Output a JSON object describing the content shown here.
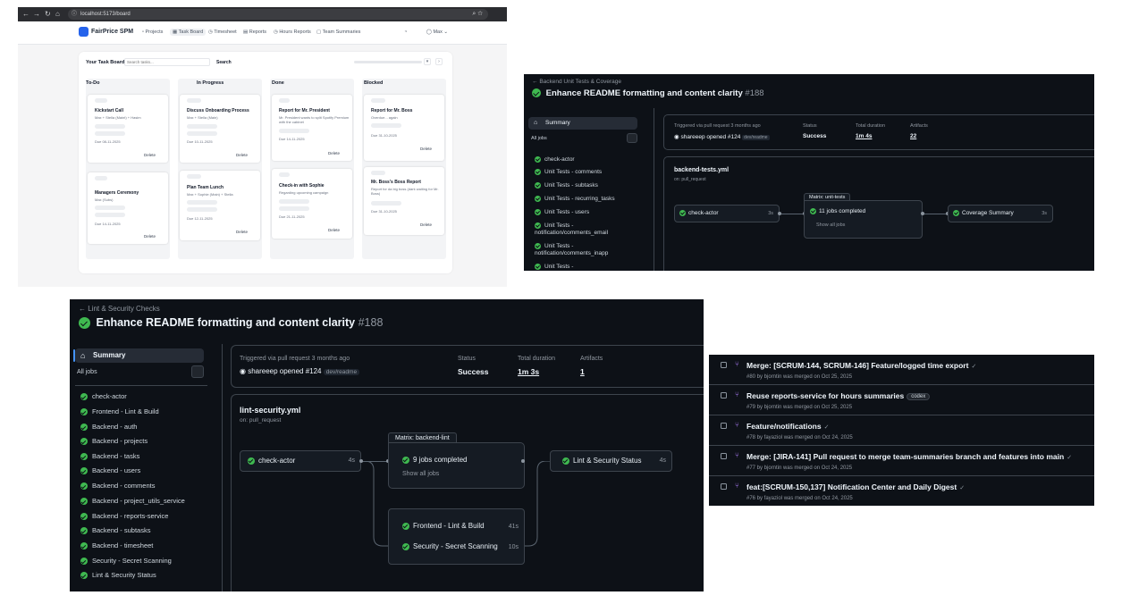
{
  "taskboard": {
    "browser": {
      "url": "localhost:5173/board"
    },
    "brand": "FairPrice SPM",
    "nav": [
      "Projects",
      "Task Board",
      "Timesheet",
      "Reports",
      "Hours Reports",
      "Team Summaries"
    ],
    "user": "Max",
    "board_title": "Your Task Board",
    "search_placeholder": "Search tasks...",
    "search_button": "Search",
    "columns": [
      {
        "name": "To-Do",
        "cards": [
          {
            "title": "Kickstart Call",
            "meta": "Max + Stella (Maint) + Hasim",
            "date": "Due 08-11-2025",
            "delete": "Delete"
          },
          {
            "title": "Managers Ceremony",
            "meta": "Max (Subs)",
            "date": "Due 14-11-2025",
            "delete": "Delete"
          }
        ]
      },
      {
        "name": "In Progress",
        "cards": [
          {
            "title": "Discuss Onboarding Process",
            "meta": "Max + Stella (Main)",
            "date": "Due 10-11-2025",
            "delete": "Delete"
          },
          {
            "title": "Plan Team Lunch",
            "meta": "Max + Sophie (Main) + Stella",
            "date": "Due 12-11-2025",
            "delete": "Delete"
          }
        ]
      },
      {
        "name": "Done",
        "cards": [
          {
            "title": "Report for Mr. President",
            "meta": "Mr. President wants to split Spotify Premium with the cabinet",
            "date": "Due 14-11-2025",
            "delete": "Delete"
          },
          {
            "title": "Check-in with Sophie",
            "meta": "Regarding upcoming campaign",
            "date": "Due 21-11-2025",
            "delete": "Delete"
          }
        ]
      },
      {
        "name": "Blocked",
        "cards": [
          {
            "title": "Report for Mr. Boss",
            "meta": "Overdue... again",
            "date": "Due 31-10-2025",
            "delete": "Delete"
          },
          {
            "title": "Mr. Boss's Boss Report",
            "meta": "Report for da big boss (dark waiting for Mr. Boss)",
            "date": "Due 31-10-2025",
            "delete": "Delete"
          }
        ]
      }
    ]
  },
  "run_backend": {
    "breadcrumb": "Backend Unit Tests & Coverage",
    "title": "Enhance README formatting and content clarity",
    "run_number": "#188",
    "summary": "Summary",
    "all_jobs": "All jobs",
    "jobs": [
      "check-actor",
      "Unit Tests - comments",
      "Unit Tests - subtasks",
      "Unit Tests - recurring_tasks",
      "Unit Tests - users",
      "Unit Tests - notification/comments_email",
      "Unit Tests - notification/comments_inapp",
      "Unit Tests -"
    ],
    "info": {
      "trigger_label": "Triggered via pull request 3 months ago",
      "trigger_user": "shareeep opened #124",
      "branch": "dev/readme",
      "status_label": "Status",
      "status": "Success",
      "duration_label": "Total duration",
      "duration": "1m 4s",
      "artifacts_label": "Artifacts",
      "artifacts": "22"
    },
    "workflow": {
      "file": "backend-tests.yml",
      "on": "on: pull_request",
      "node1": {
        "name": "check-actor",
        "duration": "3s"
      },
      "matrix_label": "Matrix: unit-tests",
      "matrix": {
        "summary": "11 jobs completed",
        "link": "Show all jobs"
      },
      "node3": {
        "name": "Coverage Summary",
        "duration": "3s"
      }
    }
  },
  "run_lint": {
    "breadcrumb": "Lint & Security Checks",
    "title": "Enhance README formatting and content clarity",
    "run_number": "#188",
    "summary": "Summary",
    "all_jobs": "All jobs",
    "jobs": [
      "check-actor",
      "Frontend - Lint & Build",
      "Backend - auth",
      "Backend - projects",
      "Backend - tasks",
      "Backend - users",
      "Backend - comments",
      "Backend - project_utils_service",
      "Backend - reports-service",
      "Backend - subtasks",
      "Backend - timesheet",
      "Security - Secret Scanning",
      "Lint & Security Status"
    ],
    "info": {
      "trigger_label": "Triggered via pull request 3 months ago",
      "trigger_user": "shareeep opened #124",
      "branch": "dev/readme",
      "status_label": "Status",
      "status": "Success",
      "duration_label": "Total duration",
      "duration": "1m 3s",
      "artifacts_label": "Artifacts",
      "artifacts": "1"
    },
    "workflow": {
      "file": "lint-security.yml",
      "on": "on: pull_request",
      "node1": {
        "name": "check-actor",
        "duration": "4s"
      },
      "matrix_label": "Matrix: backend-lint",
      "matrix": {
        "summary": "9 jobs completed",
        "link": "Show all jobs"
      },
      "node_fe": {
        "name": "Frontend - Lint & Build",
        "duration": "41s"
      },
      "node_sec": {
        "name": "Security - Secret Scanning",
        "duration": "10s"
      },
      "node3": {
        "name": "Lint & Security Status",
        "duration": "4s"
      }
    }
  },
  "pull_requests": [
    {
      "title": "Merge: [SCRUM-144, SCRUM-146] Feature/logged time export",
      "badge": "",
      "sub": "#80 by bjorntin was merged on Oct 25, 2025"
    },
    {
      "title": "Reuse reports-service for hours summaries",
      "badge": "codex",
      "sub": "#79 by bjorntin was merged on Oct 25, 2025"
    },
    {
      "title": "Feature/notifications",
      "badge": "",
      "sub": "#78 by fayaziol was merged on Oct 24, 2025"
    },
    {
      "title": "Merge: [JIRA-141] Pull request to merge team-summaries branch and features into main",
      "badge": "",
      "sub": "#77 by bjorntin was merged on Oct 24, 2025"
    },
    {
      "title": "feat:[SCRUM-150,137] Notification Center and Daily Digest",
      "badge": "",
      "sub": "#76 by fayaziol was merged on Oct 24, 2025"
    }
  ],
  "colors": {
    "success": "#3fb950",
    "bg_dark": "#0d1117",
    "merged": "#ab7df8",
    "brand_blue": "#2563eb"
  }
}
